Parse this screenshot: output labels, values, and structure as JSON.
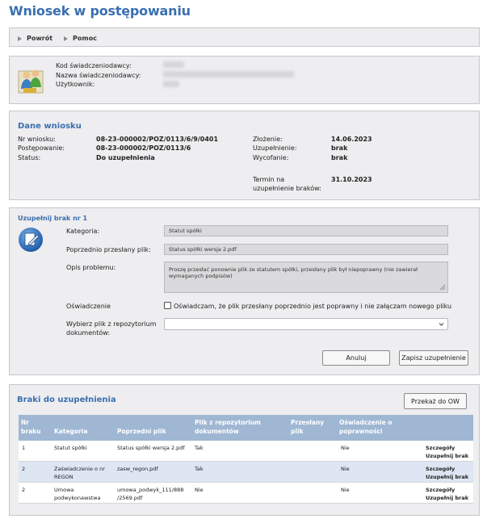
{
  "page": {
    "title": "Wniosek w postępowaniu"
  },
  "toolbar": {
    "back": "Powrót",
    "help": "Pomoc"
  },
  "provider": {
    "code_label": "Kod świadczeniodawcy:",
    "name_label": "Nazwa świadczeniodawcy:",
    "user_label": "Użytkownik:"
  },
  "application": {
    "title": "Dane wniosku",
    "nr_label": "Nr wniosku:",
    "nr_value": "08-23-000002/POZ/0113/6/9/0401",
    "proc_label": "Postępowanie:",
    "proc_value": "08-23-000002/POZ/0113/6",
    "status_label": "Status:",
    "status_value": "Do uzupełnienia",
    "submit_label": "Złożenie:",
    "submit_value": "14.06.2023",
    "supplement_label": "Uzupełnienie:",
    "supplement_value": "brak",
    "withdraw_label": "Wycofanie:",
    "withdraw_value": "brak",
    "deadline_label_1": "Termin na",
    "deadline_label_2": "uzupełnienie braków:",
    "deadline_value": "31.10.2023"
  },
  "supplement": {
    "title": "Uzupełnij brak nr 1",
    "category_label": "Kategoria:",
    "category_value": "Statut spółki",
    "prev_file_label": "Poprzednio przesłany plik:",
    "prev_file_value": "Status spółki wersja 2.pdf",
    "problem_label": "Opis problemu:",
    "problem_value": "Proszę przesłać ponownie plik ze statutem spółki, przesłany plik był niepoprawny (nie zawierał wymaganych podpisów)",
    "declaration_label": "Oświadczenie",
    "declaration_text": "Oświadczam, że plik przesłany poprzednio jest poprawny i nie załączam nowego pliku",
    "repo_label_1": "Wybierz plik z repozytorium",
    "repo_label_2": "dokumentów:",
    "repo_value": "",
    "cancel_btn": "Anuluj",
    "save_btn": "Zapisz uzupełnienie"
  },
  "deficiencies": {
    "title": "Braki do uzupełnienia",
    "forward_btn": "Przekaż do OW",
    "headers": {
      "nr_1": "Nr",
      "nr_2": "braku",
      "category": "Kategoria",
      "prev_file": "Poprzedni plik",
      "repo_1": "Plik z repozytorium",
      "repo_2": "dokumentów",
      "sent_1": "Przesłany",
      "sent_2": "plik",
      "decl_1": "Oświadczenie o",
      "decl_2": "poprawności"
    },
    "rows": [
      {
        "nr": "1",
        "category_1": "Statut spółki",
        "category_2": "",
        "file_1": "Status spółki wersja 2.pdf",
        "file_2": "",
        "repo": "Tak",
        "decl": "Nie",
        "details": "Szczegóły",
        "fill": "Uzupełnij brak"
      },
      {
        "nr": "2",
        "category_1": "Zaświadczenie o nr",
        "category_2": "REGON",
        "file_1": "zasw_regon.pdf",
        "file_2": "",
        "repo": "Tak",
        "decl": "Nie",
        "details": "Szczegóły",
        "fill": "Uzupełnij brak"
      },
      {
        "nr": "2",
        "category_1": "Umowa",
        "category_2": "podwykonawstwa",
        "file_1": "umowa_podwyk_111/888",
        "file_2": "/2569.pdf",
        "repo": "Nie",
        "decl": "Nie",
        "details": "Szczegóły",
        "fill": "Uzupełnij brak"
      }
    ]
  }
}
